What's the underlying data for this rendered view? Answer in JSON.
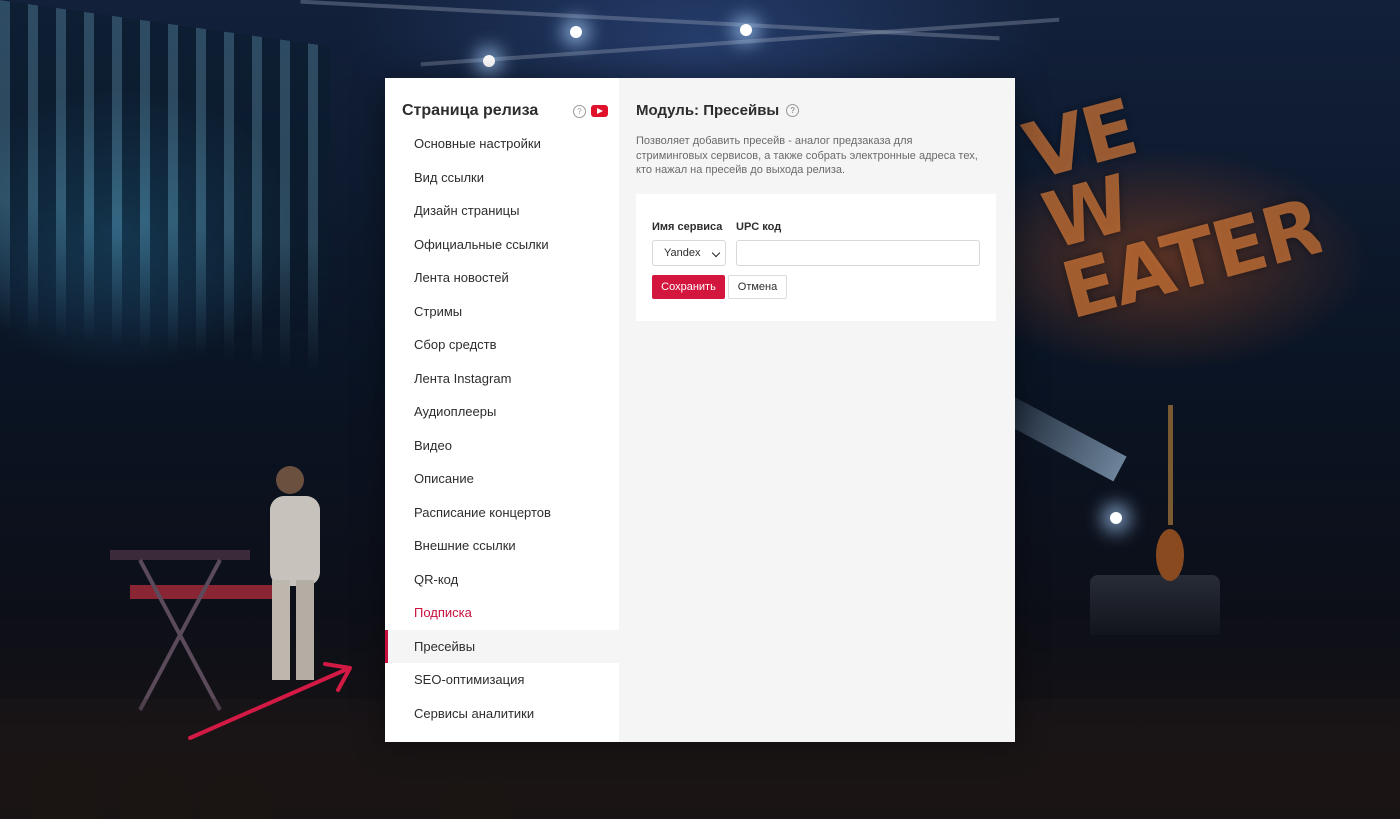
{
  "sidebar": {
    "title": "Страница релиза",
    "help_glyph": "?",
    "items": [
      {
        "label": "Основные настройки"
      },
      {
        "label": "Вид ссылки"
      },
      {
        "label": "Дизайн страницы"
      },
      {
        "label": "Официальные ссылки"
      },
      {
        "label": "Лента новостей"
      },
      {
        "label": "Стримы"
      },
      {
        "label": "Сбор средств"
      },
      {
        "label": "Лента Instagram"
      },
      {
        "label": "Аудиоплееры"
      },
      {
        "label": "Видео"
      },
      {
        "label": "Описание"
      },
      {
        "label": "Расписание концертов"
      },
      {
        "label": "Внешние ссылки"
      },
      {
        "label": "QR-код"
      },
      {
        "label": "Подписка"
      },
      {
        "label": "Пресейвы"
      },
      {
        "label": "SEO-оптимизация"
      },
      {
        "label": "Сервисы аналитики"
      }
    ],
    "highlighted_item": "Подписка",
    "active_item": "Пресейвы"
  },
  "module": {
    "title": "Модуль: Пресейвы",
    "description": "Позволяет добавить пресейв - аналог предзаказа для стриминговых сервисов, а также собрать электронные адреса тех, кто нажал на пресейв до выхода релиза."
  },
  "form": {
    "service_label": "Имя сервиса",
    "service_value": "Yandex",
    "upc_label": "UPC код",
    "upc_value": "",
    "save_label": "Сохранить",
    "cancel_label": "Отмена"
  },
  "background": {
    "stage_sign_lines": [
      "VE",
      "W",
      "EATERS"
    ]
  },
  "colors": {
    "accent": "#d3163e",
    "highlight_text": "#c8103e",
    "youtube": "#e0122b"
  },
  "icons": {
    "help": "help-icon",
    "youtube": "youtube-icon",
    "dropdown": "chevron-down-icon",
    "annotation_arrow": "arrow-icon"
  }
}
